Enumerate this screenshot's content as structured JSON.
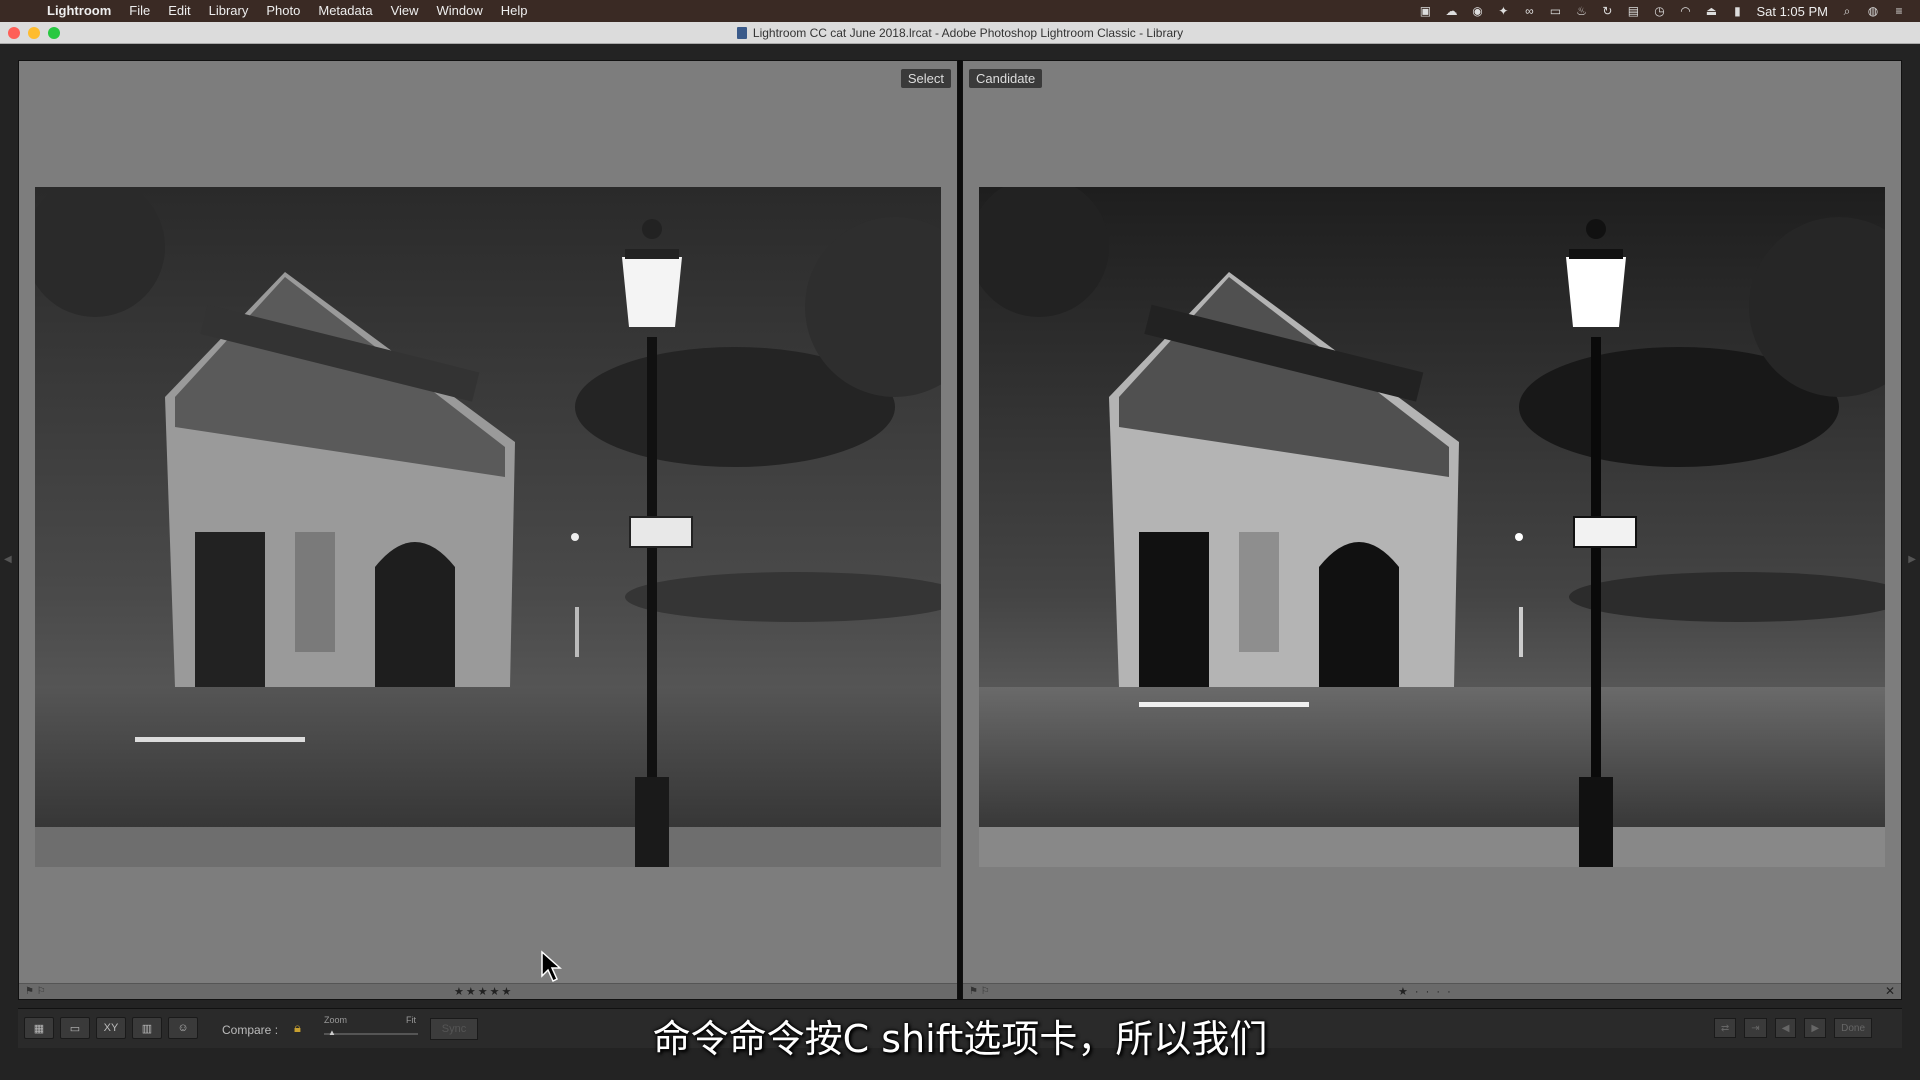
{
  "menubar": {
    "app_name": "Lightroom",
    "items": [
      "File",
      "Edit",
      "Library",
      "Photo",
      "Metadata",
      "View",
      "Window",
      "Help"
    ],
    "clock": "Sat 1:05 PM"
  },
  "window": {
    "title": "Lightroom CC cat June 2018.lrcat - Adobe Photoshop Lightroom Classic - Library"
  },
  "compare": {
    "left_label": "Select",
    "right_label": "Candidate",
    "left_rating": "★★★★★",
    "right_rating": "★ · · · ·"
  },
  "toolbar": {
    "compare_label": "Compare :",
    "zoom_label": "Zoom",
    "fit_label": "Fit",
    "sync_label": "Sync",
    "done_label": "Done"
  },
  "subtitle": "命令命令按C shift选项卡，所以我们",
  "icons": {
    "grid": "grid-icon",
    "loupe": "loupe-icon",
    "compare": "compare-icon",
    "survey": "survey-icon",
    "people": "people-icon"
  }
}
